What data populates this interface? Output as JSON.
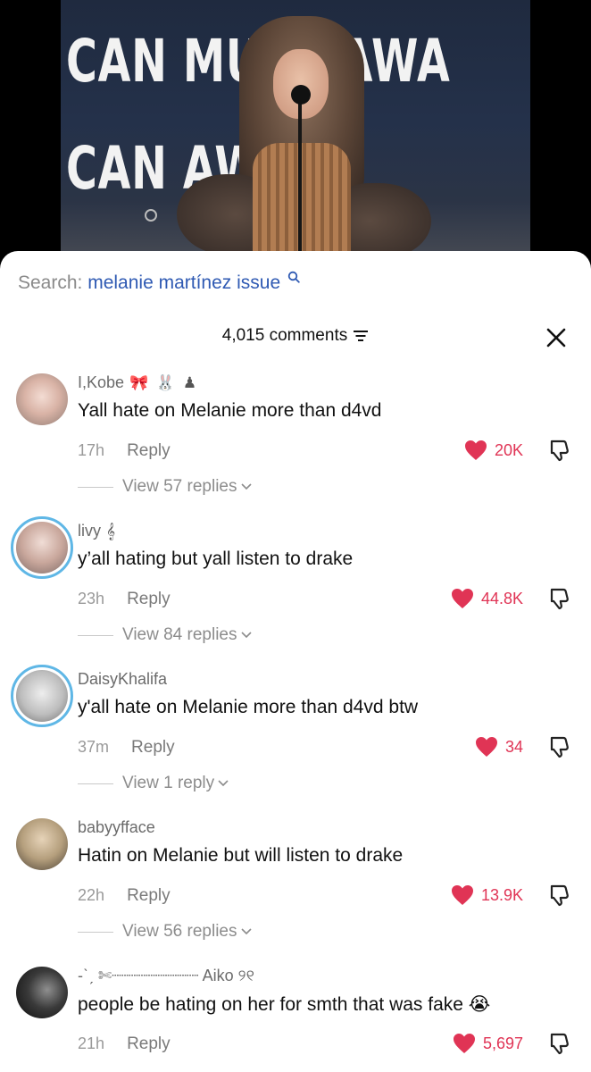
{
  "video": {
    "banner_line1": "CAN MU   IC AWA",
    "banner_line2": "CAN      AWA"
  },
  "search": {
    "label": "Search:",
    "term": "melanie martínez issue",
    "icon": "search-icon"
  },
  "comments_header": {
    "count_label": "4,015 comments",
    "filter_icon": "filter-icon",
    "close_icon": "close-icon"
  },
  "colors": {
    "like_red": "#e03455",
    "search_blue": "#2f5ab3",
    "story_ring": "#5fb7e6"
  },
  "comments": [
    {
      "username": "I,Kobe",
      "username_deco": "🎀 🐰 ♟",
      "text": "Yall hate on Melanie more than d4vd",
      "time": "17h",
      "reply_label": "Reply",
      "likes": "20K",
      "view_replies": "View 57 replies",
      "story_ring": false
    },
    {
      "username": "livy",
      "username_deco": "𝄞",
      "text": "y’all hating but yall listen to drake",
      "time": "23h",
      "reply_label": "Reply",
      "likes": "44.8K",
      "view_replies": "View 84 replies",
      "story_ring": true
    },
    {
      "username": "DaisyKhalifa",
      "username_deco": "",
      "text": "y'all hate on Melanie more than d4vd btw",
      "time": "37m",
      "reply_label": "Reply",
      "likes": "34",
      "view_replies": "View 1 reply",
      "story_ring": true
    },
    {
      "username": "babyyfface",
      "username_deco": "",
      "text": "Hatin on Melanie but will listen to drake",
      "time": "22h",
      "reply_label": "Reply",
      "likes": "13.9K",
      "view_replies": "View 56 replies",
      "story_ring": false
    },
    {
      "username": "-ˋˏ ✄┈┈┈┈┈┈┈┈┈ Aiko ୨୧",
      "username_deco": "",
      "text": "people be hating on her for smth that was fake 😭",
      "time": "21h",
      "reply_label": "Reply",
      "likes": "5,697",
      "view_replies": "",
      "story_ring": false
    }
  ]
}
